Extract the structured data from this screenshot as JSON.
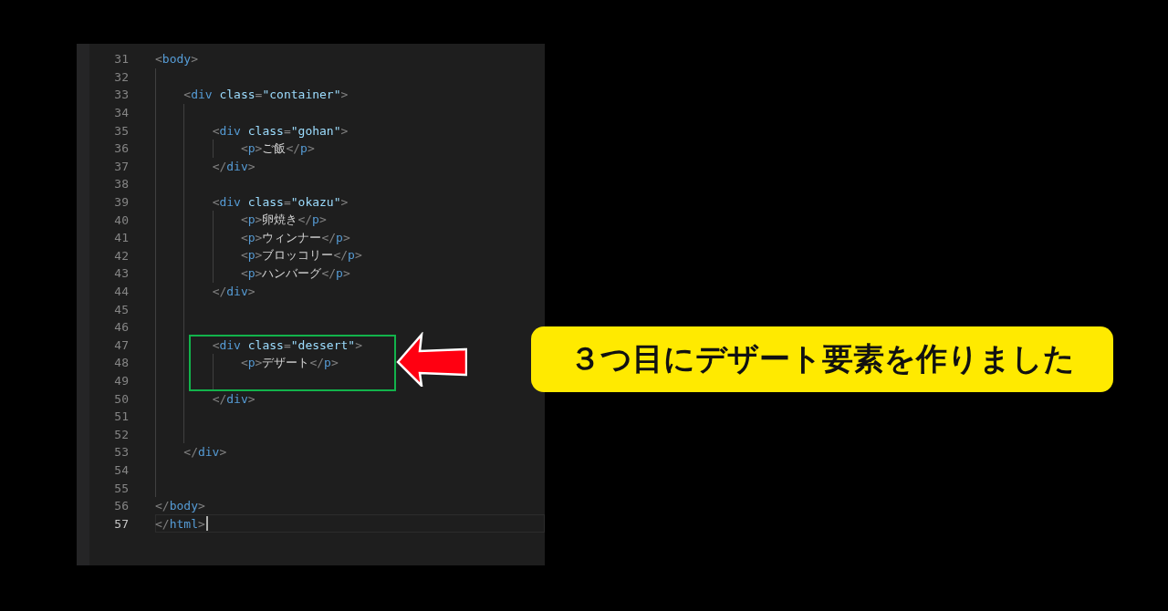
{
  "editor": {
    "lines": [
      {
        "number": "31",
        "code": "<body>",
        "current": false,
        "boxed": false
      },
      {
        "number": "32",
        "current": false,
        "boxed": false
      },
      {
        "number": "33",
        "code": "    <div class=\"container\">",
        "current": false,
        "boxed": false
      },
      {
        "number": "34",
        "current": false,
        "boxed": false
      },
      {
        "number": "35",
        "code": "        <div class=\"gohan\">",
        "current": false,
        "boxed": false
      },
      {
        "number": "36",
        "code": "            <p>ご飯</p>",
        "current": false,
        "boxed": false
      },
      {
        "number": "37",
        "code": "        </div>",
        "current": false,
        "boxed": false
      },
      {
        "number": "38",
        "current": false,
        "boxed": false
      },
      {
        "number": "39",
        "code": "        <div class=\"okazu\">",
        "current": false,
        "boxed": false
      },
      {
        "number": "40",
        "code": "            <p>卵焼き</p>",
        "current": false,
        "boxed": false
      },
      {
        "number": "41",
        "code": "            <p>ウィンナー</p>",
        "current": false,
        "boxed": false
      },
      {
        "number": "42",
        "code": "            <p>ブロッコリー</p>",
        "current": false,
        "boxed": false
      },
      {
        "number": "43",
        "code": "            <p>ハンバーグ</p>",
        "current": false,
        "boxed": false
      },
      {
        "number": "44",
        "code": "        </div>",
        "current": false,
        "boxed": false
      },
      {
        "number": "45",
        "current": false,
        "boxed": false
      },
      {
        "number": "46",
        "current": false,
        "boxed": false
      },
      {
        "number": "47",
        "code": "        <div class=\"dessert\">",
        "current": false,
        "boxed": true
      },
      {
        "number": "48",
        "code": "            <p>デザート</p>",
        "current": false,
        "boxed": true
      },
      {
        "number": "49",
        "current": false,
        "boxed": true
      },
      {
        "number": "50",
        "code": "        </div>",
        "current": false,
        "boxed": false
      },
      {
        "number": "51",
        "current": false,
        "boxed": false
      },
      {
        "number": "52",
        "current": false,
        "boxed": false
      },
      {
        "number": "53",
        "code": "    </div>",
        "current": false,
        "boxed": false
      },
      {
        "number": "54",
        "current": false,
        "boxed": false
      },
      {
        "number": "55",
        "current": false,
        "boxed": false
      },
      {
        "number": "56",
        "code": "</body>",
        "current": false,
        "boxed": false
      },
      {
        "number": "57",
        "code": "</html>",
        "current": true,
        "boxed": false
      }
    ]
  },
  "callout": {
    "text": "３つ目にデザート要素を作りました"
  }
}
